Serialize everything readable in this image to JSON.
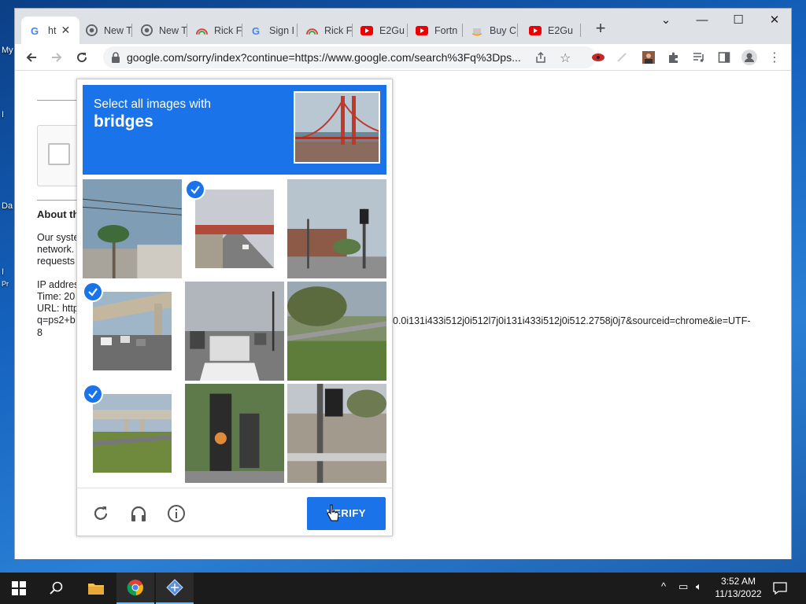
{
  "desktop": {
    "labels": [
      "My",
      "I",
      "Da",
      "I",
      "Pr"
    ]
  },
  "browser": {
    "tabs": [
      {
        "title": "ht",
        "icon": "google-g-icon",
        "active": true
      },
      {
        "title": "New T",
        "icon": "chrome-icon"
      },
      {
        "title": "New T",
        "icon": "chrome-icon"
      },
      {
        "title": "Rick F",
        "icon": "rainbow-icon"
      },
      {
        "title": "Sign I",
        "icon": "google-g-icon"
      },
      {
        "title": "Rick F",
        "icon": "rainbow-icon"
      },
      {
        "title": "E2Gu",
        "icon": "youtube-icon"
      },
      {
        "title": "Fortn",
        "icon": "youtube-icon"
      },
      {
        "title": "Buy C",
        "icon": "amazon-icon"
      },
      {
        "title": "E2Gu",
        "icon": "youtube-icon"
      }
    ],
    "url": "google.com/sorry/index?continue=https://www.google.com/search%3Fq%3Dps..."
  },
  "page": {
    "about_title": "About th",
    "paragraph": [
      "Our syste",
      "network.",
      "requests"
    ],
    "info": [
      "IP addres",
      "Time: 20",
      "URL: http",
      "q=ps2+b"
    ],
    "url_tail": "0.0i131i433i512j0i512l7j0i131i433i512j0i512.2758j0j7&sourceid=chrome&ie=UTF-",
    "url_tail2": "8"
  },
  "captcha": {
    "instruction_line1": "Select all images with",
    "instruction_target": "bridges",
    "verify_label": "VERIFY",
    "tiles": [
      {
        "scene": "palm-tree-wires",
        "selected": false
      },
      {
        "scene": "overpass-road",
        "selected": true
      },
      {
        "scene": "street-traffic-light",
        "selected": false
      },
      {
        "scene": "freeway-overpass-traffic",
        "selected": true
      },
      {
        "scene": "busy-street-cars",
        "selected": false
      },
      {
        "scene": "grass-trees",
        "selected": false
      },
      {
        "scene": "overpass-grass",
        "selected": true
      },
      {
        "scene": "traffic-light-closeup",
        "selected": false
      },
      {
        "scene": "traffic-light-pole",
        "selected": false
      }
    ]
  },
  "taskbar": {
    "time": "3:52 AM",
    "date": "11/13/2022"
  }
}
